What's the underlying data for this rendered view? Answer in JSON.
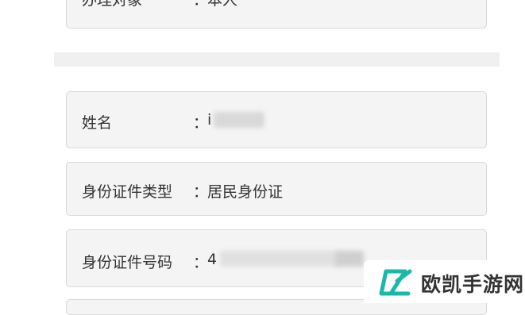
{
  "form": {
    "subject": {
      "label": "办理对象",
      "colon": "：",
      "value": "本人"
    },
    "name": {
      "label": "姓名",
      "colon": "：",
      "value_visible": "i"
    },
    "id_type": {
      "label": "身份证件类型",
      "colon": "：",
      "value": "居民身份证"
    },
    "id_number": {
      "label": "身份证件号码",
      "colon": "：",
      "value_visible": "4"
    }
  },
  "watermark": {
    "text": "欧凯手游网",
    "accent_color": "#19b8a8"
  },
  "icons": {
    "dropdown": "chevron-down-icon",
    "brand": "brand-logo-icon"
  }
}
